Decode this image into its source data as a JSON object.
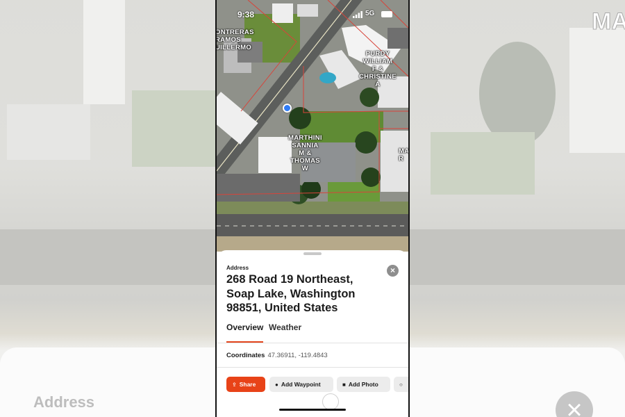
{
  "status_bar": {
    "time": "9:38",
    "network": "5G",
    "icons": [
      "location-arrow-icon",
      "signal-bars-icon",
      "battery-icon"
    ]
  },
  "map": {
    "parcel_labels": [
      {
        "text": "ONTRERAS\nRAMOS\nUILLERMO"
      },
      {
        "text": "PURDY\nWILLIAM\nF &\nCHRISTINE\nA"
      },
      {
        "text": "MARTHINI\nSANNIA\nM &\nTHOMAS\nW"
      },
      {
        "text": "MA\nR"
      }
    ]
  },
  "sheet": {
    "section_label": "Address",
    "address": "268 Road 19 Northeast, Soap Lake, Washington 98851, United States",
    "tabs": [
      {
        "label": "Overview",
        "selected": true
      },
      {
        "label": "Weather",
        "selected": false
      }
    ],
    "coordinates_label": "Coordinates",
    "coordinates_value": "47.36911, -119.4843",
    "actions": {
      "share": "Share",
      "add_waypoint": "Add Waypoint",
      "add_photo": "Add Photo"
    }
  },
  "background": {
    "address_label": "Address",
    "map_text": "MA"
  },
  "colors": {
    "accent": "#e84318",
    "location_dot": "#2f7cf6",
    "parcel_line": "#d8443a"
  }
}
